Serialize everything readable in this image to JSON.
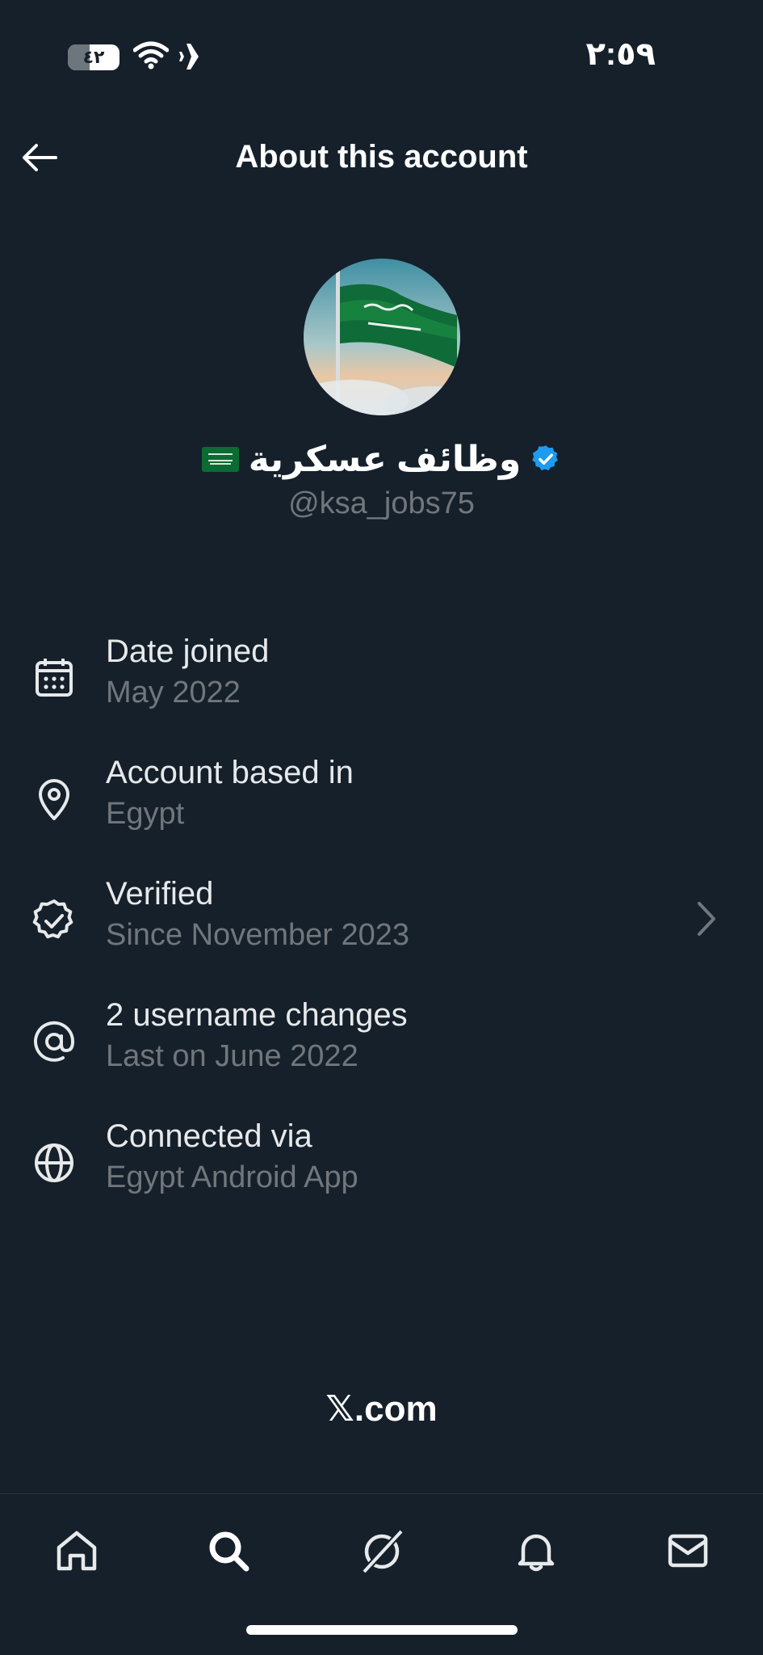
{
  "status_bar": {
    "battery_level": "٤٢",
    "battery_fraction": 0.42,
    "time": "٢:٥٩"
  },
  "header": {
    "title": "About this account",
    "back_icon": "arrow-left-icon"
  },
  "profile": {
    "display_name": "وظائف عسكرية",
    "handle": "@ksa_jobs75",
    "verified_badge_color": "#1d9bf0",
    "flag_icon": "saudi-flag-icon"
  },
  "info": {
    "items": [
      {
        "icon": "calendar-icon",
        "title": "Date joined",
        "subtitle": "May 2022"
      },
      {
        "icon": "location-pin-icon",
        "title": "Account based in",
        "subtitle": "Egypt"
      },
      {
        "icon": "verified-badge-icon",
        "title": "Verified",
        "subtitle": "Since November 2023"
      },
      {
        "icon": "at-sign-icon",
        "title": "2 username changes",
        "subtitle": "Last on June 2022"
      },
      {
        "icon": "globe-icon",
        "title": "Connected via",
        "subtitle": "Egypt Android App"
      }
    ]
  },
  "footer": {
    "brand": "𝕏.com"
  },
  "nav": {
    "items": [
      "home-icon",
      "search-icon",
      "grok-icon",
      "notifications-bell-icon",
      "messages-mail-icon"
    ]
  },
  "colors": {
    "background": "#15202b",
    "text_primary": "#e7e9ea",
    "text_secondary": "#71767b",
    "accent": "#1d9bf0"
  }
}
